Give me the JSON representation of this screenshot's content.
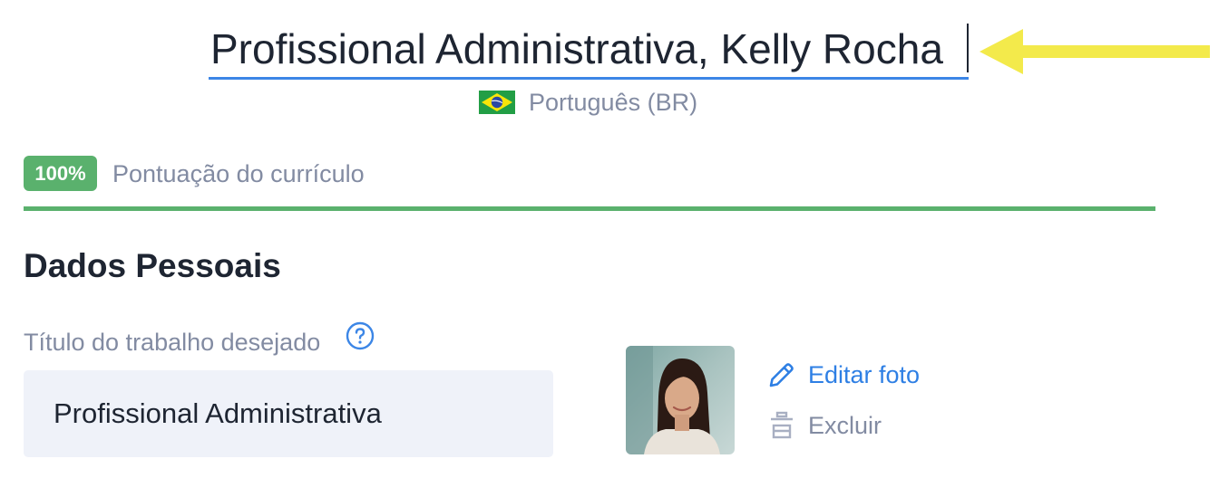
{
  "resume": {
    "title": "Profissional Administrativa, Kelly Rocha",
    "language": {
      "label": "Português (BR)",
      "flag_icon": "brazil-flag-icon"
    }
  },
  "score": {
    "badge": "100%",
    "label": "Pontuação do currículo",
    "progress_percent": 100,
    "color": "#5ab16d"
  },
  "personal_details": {
    "heading": "Dados Pessoais",
    "job_title": {
      "label": "Título do trabalho desejado",
      "value": "Profissional Administrativa",
      "help_icon": "question-circle-icon"
    },
    "photo": {
      "edit_label": "Editar foto",
      "edit_icon": "pencil-icon",
      "delete_label": "Excluir",
      "delete_icon": "trash-icon"
    }
  },
  "annotation": {
    "arrow_color": "#f3ea4b"
  },
  "colors": {
    "accent": "#3c86e6",
    "link": "#2e7fe4",
    "muted": "#828ba2",
    "text": "#1e2532",
    "input_bg": "#eff2f9"
  }
}
